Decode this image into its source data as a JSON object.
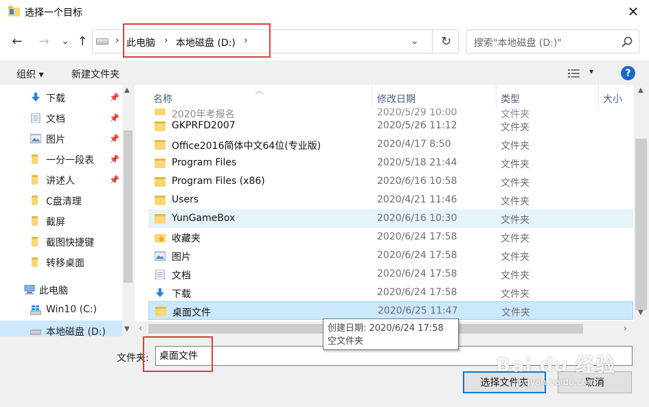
{
  "window": {
    "title": "选择一个目标",
    "close": "✕"
  },
  "nav": {
    "back": "←",
    "forward": "→",
    "recent": "⌄",
    "up": "↑",
    "breadcrumb": [
      "此电脑",
      "本地磁盘 (D:)"
    ],
    "separator": "›",
    "dropdown": "⌄",
    "refresh": "↻",
    "search_placeholder": "搜索\"本地磁盘 (D:)\""
  },
  "toolbar": {
    "organize": "组织 ▾",
    "new_folder": "新建文件夹",
    "view_dropdown": "▾",
    "help": "?"
  },
  "sidebar": {
    "items": [
      {
        "label": "下载",
        "icon": "download-arrow-icon",
        "pinned": true
      },
      {
        "label": "文档",
        "icon": "document-icon",
        "pinned": true
      },
      {
        "label": "图片",
        "icon": "picture-icon",
        "pinned": true
      },
      {
        "label": "一分一段表",
        "icon": "folder-icon",
        "pinned": true
      },
      {
        "label": "讲述人",
        "icon": "folder-icon",
        "pinned": true
      },
      {
        "label": "C盘清理",
        "icon": "folder-icon",
        "pinned": false
      },
      {
        "label": "截屏",
        "icon": "folder-icon",
        "pinned": false
      },
      {
        "label": "截图快捷键",
        "icon": "folder-icon",
        "pinned": false
      },
      {
        "label": "转移桌面",
        "icon": "folder-icon",
        "pinned": false
      },
      {
        "label": "此电脑",
        "icon": "computer-icon",
        "pinned": false
      },
      {
        "label": "Win10 (C:)",
        "icon": "windows-drive-icon",
        "pinned": false
      },
      {
        "label": "本地磁盘 (D:)",
        "icon": "drive-icon",
        "pinned": false
      }
    ],
    "pin_glyph": "📌"
  },
  "columns": {
    "name": "名称",
    "modified": "修改日期",
    "type": "类型",
    "size": "大小"
  },
  "rows": [
    {
      "name": "2020年考报名",
      "date": "2020/5/29 10:00",
      "type": "文件夹",
      "icon": "folder-icon"
    },
    {
      "name": "GKPRFD2007",
      "date": "2020/5/26 11:12",
      "type": "文件夹",
      "icon": "folder-icon"
    },
    {
      "name": "Office2016简体中文64位(专业版)",
      "date": "2020/4/17 8:50",
      "type": "文件夹",
      "icon": "folder-icon"
    },
    {
      "name": "Program Files",
      "date": "2020/5/18 21:44",
      "type": "文件夹",
      "icon": "folder-icon"
    },
    {
      "name": "Program Files (x86)",
      "date": "2020/6/16 10:58",
      "type": "文件夹",
      "icon": "folder-icon"
    },
    {
      "name": "Users",
      "date": "2020/4/21 11:46",
      "type": "文件夹",
      "icon": "folder-icon"
    },
    {
      "name": "YunGameBox",
      "date": "2020/6/16 10:30",
      "type": "文件夹",
      "icon": "folder-icon"
    },
    {
      "name": "收藏夹",
      "date": "2020/6/24 17:58",
      "type": "文件夹",
      "icon": "favorites-folder-icon"
    },
    {
      "name": "图片",
      "date": "2020/6/24 17:58",
      "type": "文件夹",
      "icon": "picture-icon"
    },
    {
      "name": "文档",
      "date": "2020/6/24 17:58",
      "type": "文件夹",
      "icon": "document-icon"
    },
    {
      "name": "下载",
      "date": "2020/6/24 17:58",
      "type": "文件夹",
      "icon": "download-arrow-icon"
    },
    {
      "name": "桌面文件",
      "date": "2020/6/25 11:47",
      "type": "文件夹",
      "icon": "folder-icon"
    }
  ],
  "tooltip": {
    "line1": "创建日期: 2020/6/24 17:58",
    "line2": "空文件夹"
  },
  "bottom": {
    "folder_label": "文件夹:",
    "folder_value": "桌面文件",
    "select_button": "选择文件夹",
    "cancel_button": "取消"
  },
  "watermark": {
    "main": "Bai du 经验",
    "sub": "jingyan.baidu.com"
  },
  "colors": {
    "accent": "#0078d7",
    "selection": "#cce8ff",
    "hover": "#e5f3fb",
    "annotation": "#e03a3a",
    "folder": "#f8d775"
  }
}
